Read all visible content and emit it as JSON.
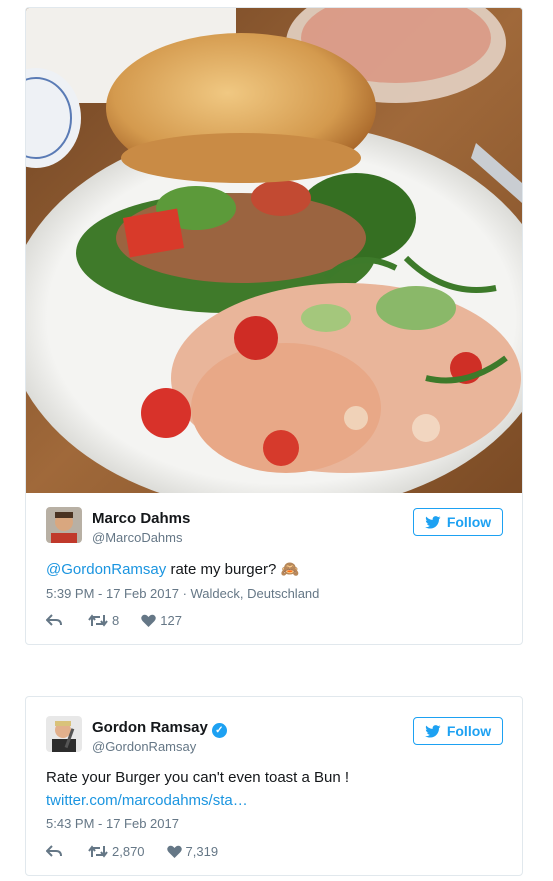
{
  "tweets": [
    {
      "name": "Marco Dahms",
      "handle": "@MarcoDahms",
      "follow_label": "Follow",
      "mention": "@GordonRamsay",
      "body": " rate my burger?",
      "emoji": "🙈",
      "timestamp": "5:39 PM - 17 Feb 2017 · Waldeck, Deutschland",
      "retweets": "8",
      "likes": "127",
      "icons": [
        "reply-icon",
        "retweet-icon",
        "heart-icon"
      ]
    },
    {
      "name": "Gordon Ramsay",
      "handle": "@GordonRamsay",
      "verified": true,
      "follow_label": "Follow",
      "body": "Rate your Burger you can't even toast a Bun !",
      "link": "twitter.com/marcodahms/sta…",
      "timestamp": "5:43 PM - 17 Feb 2017",
      "retweets": "2,870",
      "likes": "7,319",
      "icons": [
        "reply-icon",
        "retweet-icon",
        "heart-icon"
      ]
    }
  ],
  "colors": {
    "accent": "#1da1f2",
    "link": "#1b95e0",
    "muted": "#657786"
  }
}
